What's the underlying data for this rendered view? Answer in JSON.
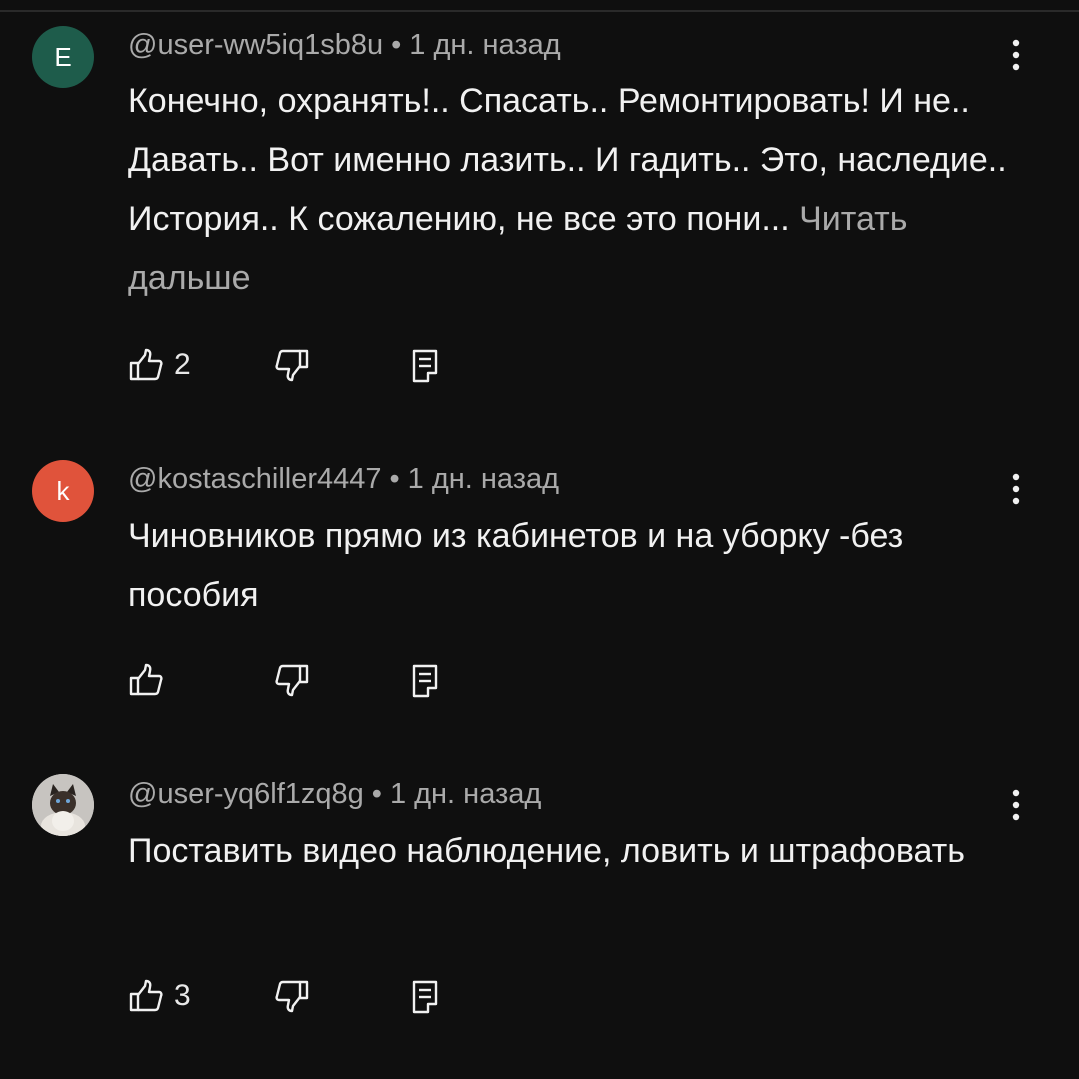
{
  "comments": [
    {
      "avatar_letter": "E",
      "avatar_color": "#1e5c4b",
      "author": "@user-ww5iq1sb8u",
      "separator": "•",
      "time": "1 дн. назад",
      "text": "Конечно, охранять!.. Спасать.. Ремонтировать! И не.. Давать.. Вот именно лазить.. И гадить.. Это, наследие.. История.. К сожалению, не все это пони...",
      "read_more": "Читать дальше",
      "likes": "2"
    },
    {
      "avatar_letter": "k",
      "avatar_color": "#e0533b",
      "author": "@kostaschiller4447",
      "separator": "•",
      "time": "1 дн. назад",
      "text": "Чиновников прямо из кабинетов и на уборку -без пособия",
      "likes": ""
    },
    {
      "avatar_letter": "",
      "avatar_color": "#b9b9b9",
      "author": "@user-yq6lf1zq8g",
      "separator": "•",
      "time": "1 дн. назад",
      "text": "Поставить видео наблюдение, ловить и штрафовать",
      "likes": "3"
    }
  ],
  "icons": {
    "like": "thumbs-up-icon",
    "dislike": "thumbs-down-icon",
    "reply": "reply-icon",
    "more": "more-vertical-icon"
  }
}
